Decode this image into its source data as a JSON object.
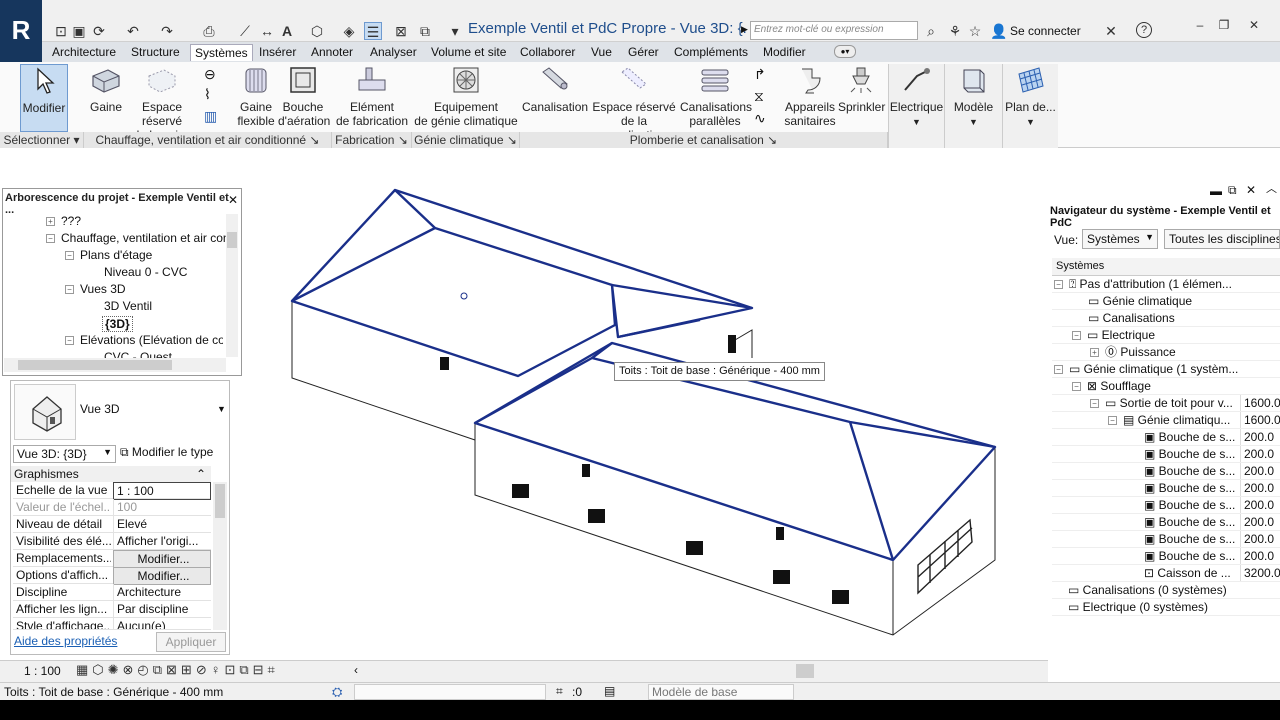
{
  "app": {
    "logo": "R",
    "doc_title": "Exemple Ventil et PdC Propre - Vue 3D: {...",
    "search_placeholder": "Entrez mot-clé ou expression",
    "login_label": "Se connecter",
    "help_icon": "?"
  },
  "menu": {
    "tabs": [
      "Architecture",
      "Structure",
      "Systèmes",
      "Insérer",
      "Annoter",
      "Analyser",
      "Volume et site",
      "Collaborer",
      "Vue",
      "Gérer",
      "Compléments",
      "Modifier"
    ],
    "active": "Systèmes"
  },
  "ribbon": {
    "modifier": "Modifier",
    "gaine": "Gaine",
    "espace_gaine_1": "Espace réservé",
    "espace_gaine_2": "de la gaine",
    "gaine_flex_1": "Gaine",
    "gaine_flex_2": "flexible",
    "bouche_1": "Bouche",
    "bouche_2": "d'aération",
    "element_fab_1": "Elément",
    "element_fab_2": "de fabrication",
    "equip_1": "Equipement",
    "equip_2": "de génie climatique",
    "canalisation": "Canalisation",
    "espace_canal_1": "Espace réservé",
    "espace_canal_2": "de la canalisation",
    "canal_par_1": "Canalisations",
    "canal_par_2": "parallèles",
    "appareils_1": "Appareils",
    "appareils_2": "sanitaires",
    "sprinkler": "Sprinkler",
    "electrique": "Electrique",
    "modele": "Modèle",
    "plan_de": "Plan de...",
    "panels": {
      "selectionner": "Sélectionner",
      "cvc": "Chauffage, ventilation et air conditionné",
      "fabrication": "Fabrication",
      "genie": "Génie climatique",
      "plomberie": "Plomberie et canalisation"
    }
  },
  "browser": {
    "title": "Arborescence du projet - Exemple Ventil et ...",
    "items": [
      "???",
      "Chauffage, ventilation et air con",
      "Plans d'étage",
      "Niveau 0 - CVC",
      "Vues 3D",
      "3D Ventil",
      "{3D}",
      "Elévations (Elévation de con",
      "CVC - Ouest"
    ]
  },
  "properties": {
    "type_name": "Vue 3D",
    "instance_select": "Vue 3D: {3D}",
    "edit_type": "Modifier le type",
    "group": "Graphismes",
    "rows": [
      {
        "label": "Echelle de la vue",
        "value": "1 : 100"
      },
      {
        "label": "Valeur de l'échel...",
        "value": "100"
      },
      {
        "label": "Niveau de détail",
        "value": "Elevé"
      },
      {
        "label": "Visibilité des élé...",
        "value": "Afficher l'origi..."
      },
      {
        "label": "Remplacements...",
        "value": "Modifier..."
      },
      {
        "label": "Options d'affich...",
        "value": "Modifier..."
      },
      {
        "label": "Discipline",
        "value": "Architecture"
      },
      {
        "label": "Afficher les lign...",
        "value": "Par discipline"
      },
      {
        "label": "Style d'affichage...",
        "value": "Aucun(e)"
      }
    ],
    "help_link": "Aide des propriétés",
    "apply": "Appliquer"
  },
  "navigator": {
    "title": "Navigateur du système - Exemple Ventil et PdC",
    "view_label": "Vue:",
    "view_value": "Systèmes",
    "discipline_value": "Toutes les disciplines",
    "col_header": "Systèmes",
    "rows": [
      {
        "label": "Pas d'attribution (1 élémen...",
        "value": ""
      },
      {
        "label": "Génie climatique",
        "value": ""
      },
      {
        "label": "Canalisations",
        "value": ""
      },
      {
        "label": "Electrique",
        "value": ""
      },
      {
        "label": "Puissance",
        "value": ""
      },
      {
        "label": "Génie climatique (1 systèm...",
        "value": ""
      },
      {
        "label": "Soufflage",
        "value": ""
      },
      {
        "label": "Sortie de toit pour v...",
        "value": "1600.0"
      },
      {
        "label": "Génie climatiqu...",
        "value": "1600.0"
      },
      {
        "label": "Bouche de s...",
        "value": "200.0"
      },
      {
        "label": "Bouche de s...",
        "value": "200.0"
      },
      {
        "label": "Bouche de s...",
        "value": "200.0"
      },
      {
        "label": "Bouche de s...",
        "value": "200.0"
      },
      {
        "label": "Bouche de s...",
        "value": "200.0"
      },
      {
        "label": "Bouche de s...",
        "value": "200.0"
      },
      {
        "label": "Bouche de s...",
        "value": "200.0"
      },
      {
        "label": "Bouche de s...",
        "value": "200.0"
      },
      {
        "label": "Caisson de ...",
        "value": "3200.0"
      },
      {
        "label": "Canalisations (0 systèmes)",
        "value": ""
      },
      {
        "label": "Electrique (0 systèmes)",
        "value": ""
      }
    ]
  },
  "viewport": {
    "tooltip": "Toits : Toit de base : Générique  - 400 mm",
    "scale": "1 : 100"
  },
  "status": {
    "text": "Toits : Toit de base : Générique  - 400 mm",
    "count": ":0",
    "model": "Modèle de base"
  },
  "colors": {
    "accent": "#1f4e8c",
    "roof_edge": "#1a2f8a",
    "logo_bg": "#16365d"
  }
}
